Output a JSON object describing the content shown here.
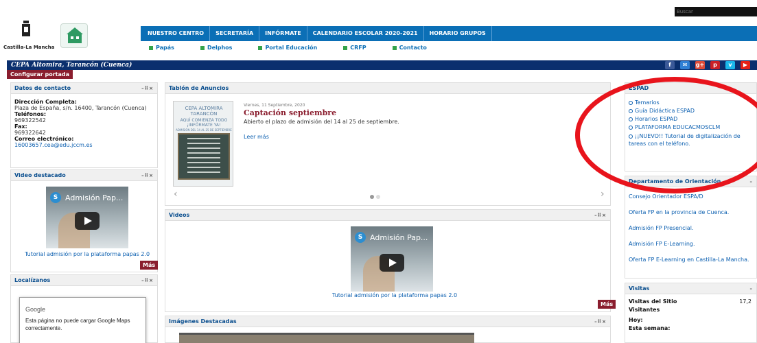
{
  "search": {
    "placeholder": "Buscar"
  },
  "header": {
    "logo_text": "Castilla-La Mancha",
    "nav_main": [
      "NUESTRO CENTRO",
      "SECRETARÍA",
      "INFÓRMATE",
      "CALENDARIO ESCOLAR 2020-2021",
      "HORARIO GRUPOS"
    ],
    "nav_sub": [
      "Papás",
      "Delphos",
      "Portal Educación",
      "CRFP",
      "Contacto"
    ],
    "title": "CEPA Altomira, Tarancón (Cuenca)",
    "config_label": "Configurar portada",
    "social": [
      {
        "icon": "facebook-icon",
        "glyph": "f",
        "color": "#3b5998"
      },
      {
        "icon": "email-icon",
        "glyph": "✉",
        "color": "#2f7fd4"
      },
      {
        "icon": "googleplus-icon",
        "glyph": "g+",
        "color": "#dd4b39"
      },
      {
        "icon": "pinterest-icon",
        "glyph": "p",
        "color": "#cb2027"
      },
      {
        "icon": "vimeo-icon",
        "glyph": "v",
        "color": "#1ab7ea"
      },
      {
        "icon": "youtube-icon",
        "glyph": "▶",
        "color": "#e62117"
      }
    ]
  },
  "panel_ctrl": "–⠿×",
  "contacto": {
    "title": "Datos de contacto",
    "direccion_label": "Dirección Completa:",
    "direccion": "Plaza de España, s/n. 16400, Tarancón (Cuenca)",
    "telefonos_label": "Teléfonos:",
    "telefono": "969322542",
    "fax_label": "Fax:",
    "fax": "969322642",
    "email_label": "Correo electrónico:",
    "email": "16003657.cea@edu.jccm.es"
  },
  "video_destacado": {
    "title": "Video destacado",
    "video_title": "Admisión Pap...",
    "video_letter": "S",
    "caption": "Tutorial admisión por la plataforma papas 2.0",
    "mas": "Más"
  },
  "localizanos": {
    "title": "Localízanos",
    "google": "Google",
    "message": "Esta página no puede cargar Google Maps correctamente."
  },
  "tablon": {
    "title": "Tablón de Anuncios",
    "date": "Viernes, 11 Septiembre, 2020",
    "headline": "Captación septiembre",
    "text": "Abierto el plazo de admisión del 14 al 25 de septiembre.",
    "leer_mas": "Leer más",
    "poster_title1": "CEPA ALTOMIRA",
    "poster_title2": "TARANCÓN",
    "poster_sub1": "AQUÍ COMIENZA TODO",
    "poster_sub2": "¡INFÓRMATE YA!",
    "poster_sub3": "ADMISIÓN DEL 14 AL 25 DE SEPTIEMBRE"
  },
  "videos": {
    "title": "Videos",
    "video_title": "Admisión Pap...",
    "video_letter": "S",
    "caption": "Tutorial admisión por la plataforma papas 2.0",
    "mas": "Más"
  },
  "imagenes": {
    "title": "Imágenes Destacadas"
  },
  "espad": {
    "title": "ESPAD",
    "items": [
      "Temarios",
      "Guía Didáctica ESPAD",
      "Horarios ESPAD",
      "PLATAFORMA EDUCACMOSCLM",
      "¡¡NUEVO!! Tutorial de digitalización de tareas con el teléfono."
    ]
  },
  "orientacion": {
    "title": "Departamento de Orientación",
    "items": [
      "Consejo Orientador ESPA/D",
      "Oferta FP en la provincia de Cuenca.",
      "Admisión FP Presencial.",
      "Admisión FP E-Learning.",
      "Oferta FP E-Learning en Castilla-La Mancha."
    ]
  },
  "visitas": {
    "title": "Visitas",
    "sitio_label": "Visitas del Sitio",
    "sitio_value": "17,2",
    "visitantes_label": "Visitantes",
    "hoy_label": "Hoy:",
    "semana_label": "Esta semana:"
  },
  "colors": {
    "nav_blue": "#0b6fb6",
    "title_bar": "#0b2f6e",
    "accent_maroon": "#8a1d2e",
    "highlight_red": "#e8141c"
  }
}
